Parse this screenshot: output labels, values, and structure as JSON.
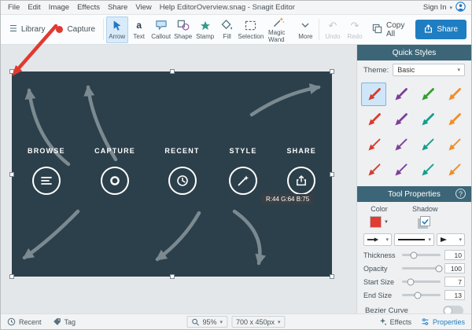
{
  "colors": {
    "accent_blue": "#2277c4",
    "share_button": "#1f7ec2",
    "canvas_bg": "#2c404b",
    "panel_header": "#3c6678",
    "annotation_red": "#e03a30",
    "swatch_red": "#e03c31"
  },
  "menu_bar": {
    "items": [
      "File",
      "Edit",
      "Image",
      "Effects",
      "Share",
      "View",
      "Help"
    ],
    "title": "EditorOverview.snag - Snagit Editor",
    "sign_in_label": "Sign In"
  },
  "toolbar": {
    "library_label": "Library",
    "capture_label": "Capture",
    "tools": [
      {
        "label": "Arrow",
        "selected": true
      },
      {
        "label": "Text"
      },
      {
        "label": "Callout"
      },
      {
        "label": "Shape"
      },
      {
        "label": "Stamp"
      },
      {
        "label": "Fill"
      },
      {
        "label": "Selection"
      },
      {
        "label": "Magic Wand"
      },
      {
        "label": "More"
      }
    ],
    "undo_label": "Undo",
    "redo_label": "Redo",
    "copy_all_label": "Copy All",
    "share_label": "Share"
  },
  "canvas": {
    "features": [
      {
        "label": "BROWSE"
      },
      {
        "label": "CAPTURE"
      },
      {
        "label": "RECENT"
      },
      {
        "label": "STYLE"
      },
      {
        "label": "SHARE"
      }
    ],
    "color_tooltip": "R:44 G:64 B:75"
  },
  "quick_styles": {
    "header": "Quick Styles",
    "theme_label": "Theme:",
    "theme_value": "Basic",
    "arrows": [
      {
        "color": "#d93a2b",
        "width": 3.2,
        "selected": true
      },
      {
        "color": "#7d3f98",
        "width": 3.2
      },
      {
        "color": "#33a02c",
        "width": 3.2
      },
      {
        "color": "#f28c28",
        "width": 3.2
      },
      {
        "color": "#d93a2b",
        "width": 3.2
      },
      {
        "color": "#7d3f98",
        "width": 3.2
      },
      {
        "color": "#129e8e",
        "width": 3.2
      },
      {
        "color": "#f28c28",
        "width": 3.2
      },
      {
        "color": "#d93a2b",
        "width": 2.2
      },
      {
        "color": "#7d3f98",
        "width": 2.2
      },
      {
        "color": "#129e8e",
        "width": 2.2
      },
      {
        "color": "#f28c28",
        "width": 2.2
      },
      {
        "color": "#d93a2b",
        "width": 2.2
      },
      {
        "color": "#7d3f98",
        "width": 2.2
      },
      {
        "color": "#129e8e",
        "width": 2.2
      },
      {
        "color": "#f28c28",
        "width": 2.2
      }
    ]
  },
  "tool_properties": {
    "header": "Tool Properties",
    "help_label": "?",
    "color_label": "Color",
    "shadow_label": "Shadow",
    "sliders": [
      {
        "label": "Thickness",
        "value": "10",
        "pct": 30
      },
      {
        "label": "Opacity",
        "value": "100",
        "pct": 95
      },
      {
        "label": "Start Size",
        "value": "7",
        "pct": 22
      },
      {
        "label": "End Size",
        "value": "13",
        "pct": 40
      }
    ],
    "bezier_label": "Bezier Curve"
  },
  "status_bar": {
    "recent_label": "Recent",
    "tag_label": "Tag",
    "zoom_value": "95%",
    "canvas_size": "700 x 450px",
    "effects_label": "Effects",
    "properties_label": "Properties"
  }
}
